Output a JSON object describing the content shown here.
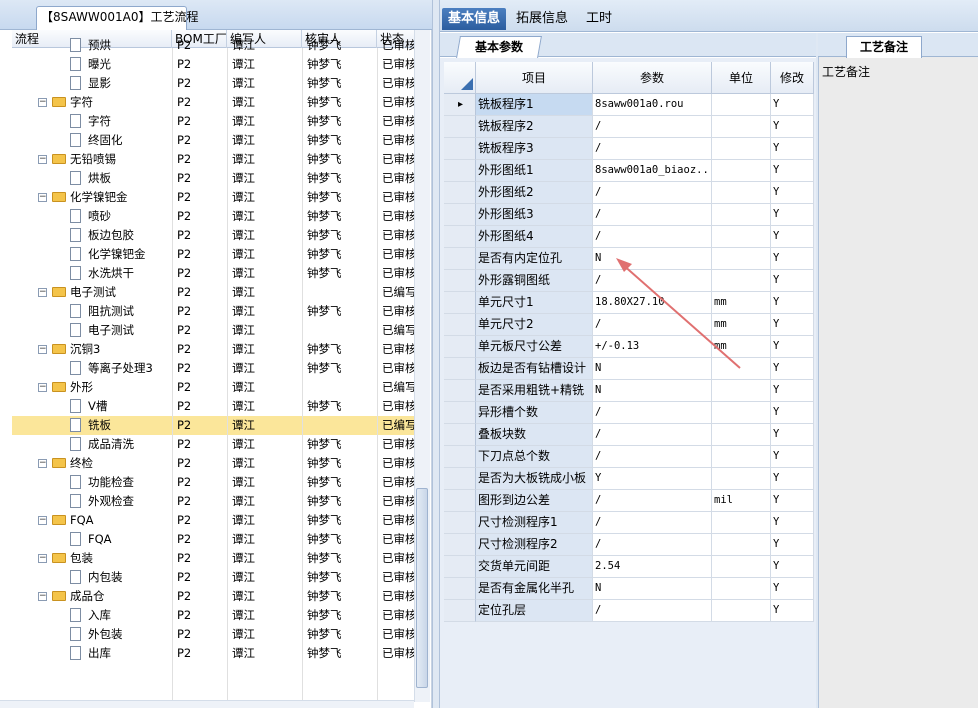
{
  "left_panel": {
    "tab_label": "【8SAWW001A0】工艺流程",
    "columns": [
      "流程",
      "BOM工厂",
      "编写人",
      "核审人",
      "状态"
    ],
    "rows": [
      {
        "level": 2,
        "type": "doc",
        "name": "预烘",
        "bom": "P2",
        "writer": "谭江",
        "reviewer": "钟梦飞",
        "status": "已审核"
      },
      {
        "level": 2,
        "type": "doc",
        "name": "曝光",
        "bom": "P2",
        "writer": "谭江",
        "reviewer": "钟梦飞",
        "status": "已审核"
      },
      {
        "level": 2,
        "type": "doc",
        "name": "显影",
        "bom": "P2",
        "writer": "谭江",
        "reviewer": "钟梦飞",
        "status": "已审核"
      },
      {
        "level": 1,
        "type": "folder",
        "name": "字符",
        "bom": "P2",
        "writer": "谭江",
        "reviewer": "钟梦飞",
        "status": "已审核"
      },
      {
        "level": 2,
        "type": "doc",
        "name": "字符",
        "bom": "P2",
        "writer": "谭江",
        "reviewer": "钟梦飞",
        "status": "已审核"
      },
      {
        "level": 2,
        "type": "doc",
        "name": "终固化",
        "bom": "P2",
        "writer": "谭江",
        "reviewer": "钟梦飞",
        "status": "已审核"
      },
      {
        "level": 1,
        "type": "folder",
        "name": "无铅喷锡",
        "bom": "P2",
        "writer": "谭江",
        "reviewer": "钟梦飞",
        "status": "已审核"
      },
      {
        "level": 2,
        "type": "doc",
        "name": "烘板",
        "bom": "P2",
        "writer": "谭江",
        "reviewer": "钟梦飞",
        "status": "已审核"
      },
      {
        "level": 1,
        "type": "folder",
        "name": "化学镍钯金",
        "bom": "P2",
        "writer": "谭江",
        "reviewer": "钟梦飞",
        "status": "已审核"
      },
      {
        "level": 2,
        "type": "doc",
        "name": "喷砂",
        "bom": "P2",
        "writer": "谭江",
        "reviewer": "钟梦飞",
        "status": "已审核"
      },
      {
        "level": 2,
        "type": "doc",
        "name": "板边包胶",
        "bom": "P2",
        "writer": "谭江",
        "reviewer": "钟梦飞",
        "status": "已审核"
      },
      {
        "level": 2,
        "type": "doc",
        "name": "化学镍钯金",
        "bom": "P2",
        "writer": "谭江",
        "reviewer": "钟梦飞",
        "status": "已审核"
      },
      {
        "level": 2,
        "type": "doc",
        "name": "水洗烘干",
        "bom": "P2",
        "writer": "谭江",
        "reviewer": "钟梦飞",
        "status": "已审核"
      },
      {
        "level": 1,
        "type": "folder",
        "name": "电子测试",
        "bom": "P2",
        "writer": "谭江",
        "reviewer": "",
        "status": "已编写"
      },
      {
        "level": 2,
        "type": "doc",
        "name": "阻抗测试",
        "bom": "P2",
        "writer": "谭江",
        "reviewer": "钟梦飞",
        "status": "已审核"
      },
      {
        "level": 2,
        "type": "doc",
        "name": "电子测试",
        "bom": "P2",
        "writer": "谭江",
        "reviewer": "",
        "status": "已编写"
      },
      {
        "level": 1,
        "type": "folder",
        "name": "沉铜3",
        "bom": "P2",
        "writer": "谭江",
        "reviewer": "钟梦飞",
        "status": "已审核"
      },
      {
        "level": 2,
        "type": "doc",
        "name": "等离子处理3",
        "bom": "P2",
        "writer": "谭江",
        "reviewer": "钟梦飞",
        "status": "已审核"
      },
      {
        "level": 1,
        "type": "folder",
        "name": "外形",
        "bom": "P2",
        "writer": "谭江",
        "reviewer": "",
        "status": "已编写"
      },
      {
        "level": 2,
        "type": "doc",
        "name": "V槽",
        "bom": "P2",
        "writer": "谭江",
        "reviewer": "钟梦飞",
        "status": "已审核"
      },
      {
        "level": 2,
        "type": "doc",
        "name": "铣板",
        "bom": "P2",
        "writer": "谭江",
        "reviewer": "",
        "status": "已编写",
        "selected": true
      },
      {
        "level": 2,
        "type": "doc",
        "name": "成品清洗",
        "bom": "P2",
        "writer": "谭江",
        "reviewer": "钟梦飞",
        "status": "已审核"
      },
      {
        "level": 1,
        "type": "folder",
        "name": "终检",
        "bom": "P2",
        "writer": "谭江",
        "reviewer": "钟梦飞",
        "status": "已审核"
      },
      {
        "level": 2,
        "type": "doc",
        "name": "功能检查",
        "bom": "P2",
        "writer": "谭江",
        "reviewer": "钟梦飞",
        "status": "已审核"
      },
      {
        "level": 2,
        "type": "doc",
        "name": "外观检查",
        "bom": "P2",
        "writer": "谭江",
        "reviewer": "钟梦飞",
        "status": "已审核"
      },
      {
        "level": 1,
        "type": "folder",
        "name": "FQA",
        "bom": "P2",
        "writer": "谭江",
        "reviewer": "钟梦飞",
        "status": "已审核"
      },
      {
        "level": 2,
        "type": "doc",
        "name": "FQA",
        "bom": "P2",
        "writer": "谭江",
        "reviewer": "钟梦飞",
        "status": "已审核"
      },
      {
        "level": 1,
        "type": "folder",
        "name": "包装",
        "bom": "P2",
        "writer": "谭江",
        "reviewer": "钟梦飞",
        "status": "已审核"
      },
      {
        "level": 2,
        "type": "doc",
        "name": "内包装",
        "bom": "P2",
        "writer": "谭江",
        "reviewer": "钟梦飞",
        "status": "已审核"
      },
      {
        "level": 1,
        "type": "folder",
        "name": "成品仓",
        "bom": "P2",
        "writer": "谭江",
        "reviewer": "钟梦飞",
        "status": "已审核"
      },
      {
        "level": 2,
        "type": "doc",
        "name": "入库",
        "bom": "P2",
        "writer": "谭江",
        "reviewer": "钟梦飞",
        "status": "已审核"
      },
      {
        "level": 2,
        "type": "doc",
        "name": "外包装",
        "bom": "P2",
        "writer": "谭江",
        "reviewer": "钟梦飞",
        "status": "已审核"
      },
      {
        "level": 2,
        "type": "doc",
        "name": "出库",
        "bom": "P2",
        "writer": "谭江",
        "reviewer": "钟梦飞",
        "status": "已审核"
      }
    ]
  },
  "right_panel": {
    "tabs": [
      "基本信息",
      "拓展信息",
      "工时"
    ],
    "active_tab": "基本信息",
    "subtab": "基本参数",
    "grid_columns": [
      "项目",
      "参数",
      "单位",
      "修改"
    ],
    "params": [
      {
        "item": "铣板程序1",
        "value": "8saww001a0.rou",
        "unit": "",
        "modify": "Y",
        "current": true
      },
      {
        "item": "铣板程序2",
        "value": "/",
        "unit": "",
        "modify": "Y"
      },
      {
        "item": "铣板程序3",
        "value": "/",
        "unit": "",
        "modify": "Y"
      },
      {
        "item": "外形图纸1",
        "value": "8saww001a0_biaoz...",
        "unit": "",
        "modify": "Y"
      },
      {
        "item": "外形图纸2",
        "value": "/",
        "unit": "",
        "modify": "Y"
      },
      {
        "item": "外形图纸3",
        "value": "/",
        "unit": "",
        "modify": "Y"
      },
      {
        "item": "外形图纸4",
        "value": "/",
        "unit": "",
        "modify": "Y"
      },
      {
        "item": "是否有内定位孔",
        "value": "N",
        "unit": "",
        "modify": "Y"
      },
      {
        "item": "外形露铜图纸",
        "value": "/",
        "unit": "",
        "modify": "Y"
      },
      {
        "item": "单元尺寸1",
        "value": "18.80X27.10",
        "unit": "mm",
        "modify": "Y"
      },
      {
        "item": "单元尺寸2",
        "value": "/",
        "unit": "mm",
        "modify": "Y"
      },
      {
        "item": "单元板尺寸公差",
        "value": "+/-0.13",
        "unit": "mm",
        "modify": "Y"
      },
      {
        "item": "板边是否有钻槽设计",
        "value": "N",
        "unit": "",
        "modify": "Y"
      },
      {
        "item": "是否采用粗铣+精铣",
        "value": "N",
        "unit": "",
        "modify": "Y"
      },
      {
        "item": "异形槽个数",
        "value": "/",
        "unit": "",
        "modify": "Y"
      },
      {
        "item": "叠板块数",
        "value": "/",
        "unit": "",
        "modify": "Y"
      },
      {
        "item": "下刀点总个数",
        "value": "/",
        "unit": "",
        "modify": "Y"
      },
      {
        "item": "是否为大板铣成小板",
        "value": "Y",
        "unit": "",
        "modify": "Y"
      },
      {
        "item": "图形到边公差",
        "value": "/",
        "unit": "mil",
        "modify": "Y"
      },
      {
        "item": "尺寸检测程序1",
        "value": "/",
        "unit": "",
        "modify": "Y"
      },
      {
        "item": "尺寸检测程序2",
        "value": "/",
        "unit": "",
        "modify": "Y"
      },
      {
        "item": "交货单元间距",
        "value": "2.54",
        "unit": "",
        "modify": "Y"
      },
      {
        "item": "是否有金属化半孔",
        "value": "N",
        "unit": "",
        "modify": "Y"
      },
      {
        "item": "定位孔层",
        "value": "/",
        "unit": "",
        "modify": "Y"
      }
    ]
  },
  "notes_panel": {
    "tab": "工艺备注",
    "label": "工艺备注"
  },
  "colors": {
    "tab_active": "#2b5d9f",
    "selected_row": "#fbe69a",
    "item_cell": "#dce6f3",
    "annotation_arrow": "#e07070"
  }
}
